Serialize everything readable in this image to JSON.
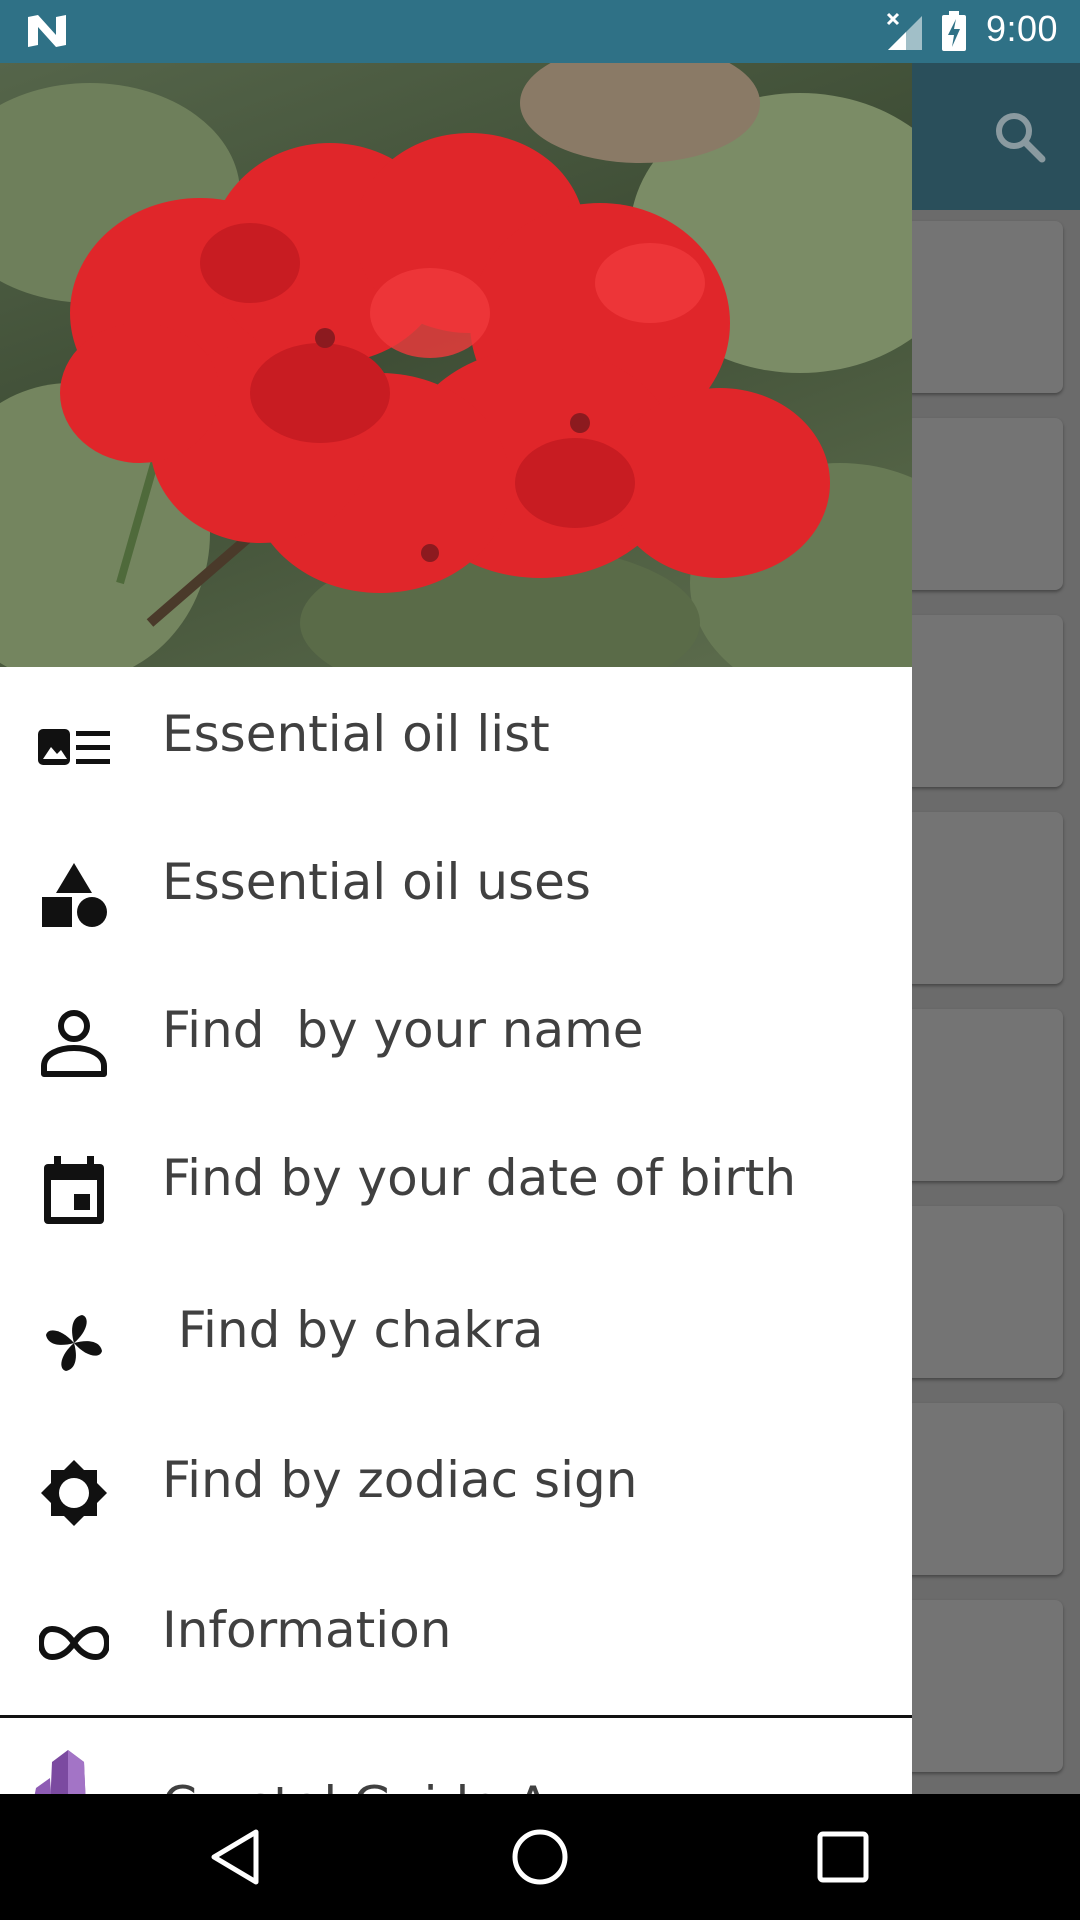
{
  "status_bar": {
    "time": "9:00",
    "icons": [
      "notification-n-icon",
      "signal-no-data-icon",
      "battery-charging-icon"
    ]
  },
  "toolbar": {
    "search_icon": "search-icon"
  },
  "drawer": {
    "header_image": "red geranium flowers",
    "items": [
      {
        "label": "Essential oil list",
        "icon": "list-image-icon"
      },
      {
        "label": "Essential oil uses",
        "icon": "shapes-icon"
      },
      {
        "label": "Find  by your name",
        "icon": "person-outline-icon"
      },
      {
        "label": "Find by your date of birth",
        "icon": "calendar-icon"
      },
      {
        "label": " Find by chakra",
        "icon": "pinwheel-icon"
      },
      {
        "label": "Find by zodiac sign",
        "icon": "brightness-icon"
      },
      {
        "label": "Information",
        "icon": "infinity-icon"
      }
    ],
    "extra_item": {
      "label": "Crystal Guide App",
      "icon": "crystal-icon"
    }
  },
  "nav_bar": {
    "icons": [
      "back-icon",
      "home-icon",
      "recents-icon"
    ]
  },
  "colors": {
    "status_bar": "#2f7186",
    "toolbar_dimmed": "#2a4f5b",
    "scrim_background": "#6b6b6b",
    "drawer_background": "#ffffff",
    "item_text": "#404040"
  }
}
